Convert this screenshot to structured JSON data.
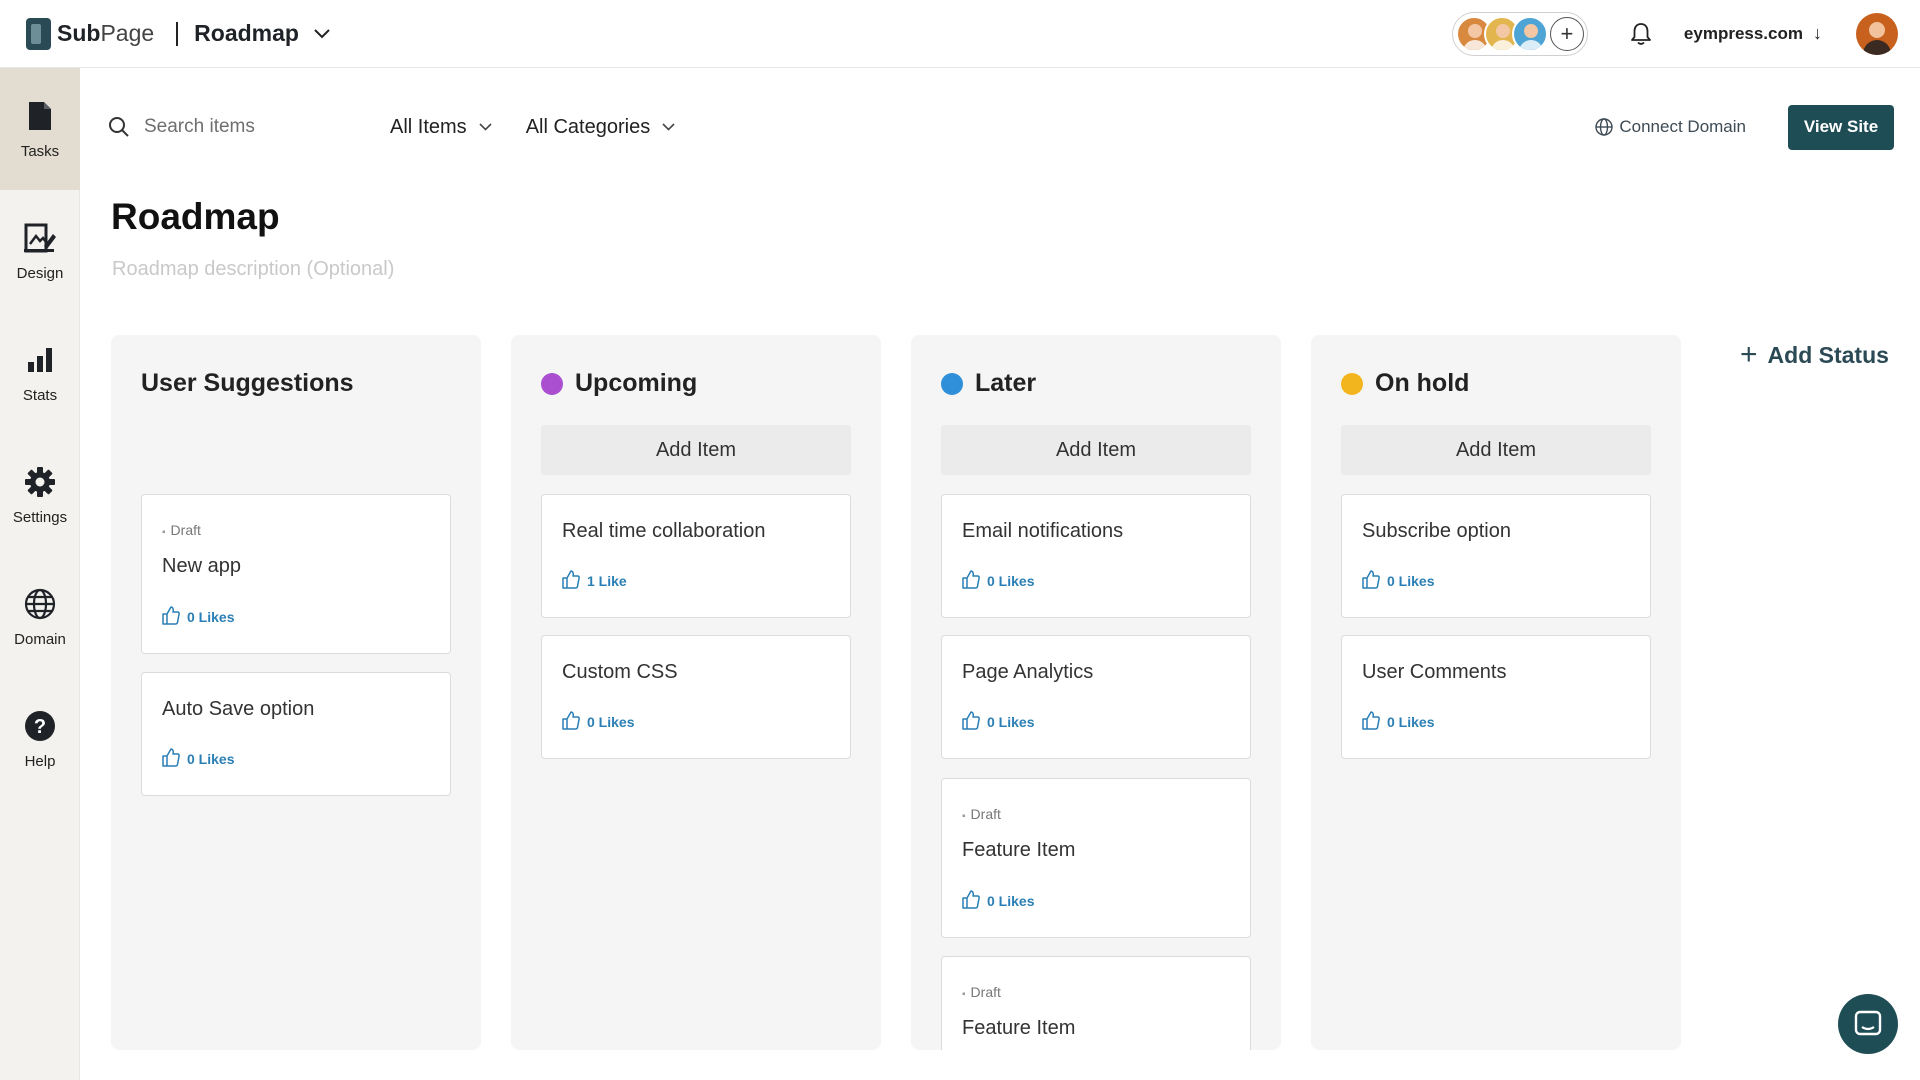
{
  "app": {
    "brand_bold": "Sub",
    "brand_rest": "Page",
    "current_page": "Roadmap",
    "site": "eympress.com"
  },
  "sidebar": {
    "items": [
      {
        "label": "Tasks",
        "icon": "tasks-icon"
      },
      {
        "label": "Design",
        "icon": "design-icon"
      },
      {
        "label": "Stats",
        "icon": "stats-icon"
      },
      {
        "label": "Settings",
        "icon": "gear-icon"
      },
      {
        "label": "Domain",
        "icon": "globe-icon"
      },
      {
        "label": "Help",
        "icon": "help-icon"
      }
    ]
  },
  "toolbar": {
    "search_placeholder": "Search items",
    "filter_items": "All Items",
    "filter_categories": "All Categories",
    "connect_domain": "Connect Domain",
    "view_site": "View Site"
  },
  "page": {
    "title": "Roadmap",
    "description_placeholder": "Roadmap description (Optional)"
  },
  "board": {
    "add_item_label": "Add Item",
    "add_status_label": "Add Status",
    "columns": [
      {
        "name": "User Suggestions",
        "dot_color": "",
        "cards": [
          {
            "draft": "Draft",
            "title": "New app",
            "likes": "0 Likes"
          },
          {
            "draft": "",
            "title": "Auto Save option",
            "likes": "0 Likes"
          }
        ]
      },
      {
        "name": "Upcoming",
        "dot_color": "#a94fd0",
        "cards": [
          {
            "draft": "",
            "title": "Real time collaboration",
            "likes": "1 Like"
          },
          {
            "draft": "",
            "title": "Custom CSS",
            "likes": "0 Likes"
          }
        ]
      },
      {
        "name": "Later",
        "dot_color": "#2f8fd8",
        "cards": [
          {
            "draft": "",
            "title": "Email notifications",
            "likes": "0 Likes"
          },
          {
            "draft": "",
            "title": "Page Analytics",
            "likes": "0 Likes"
          },
          {
            "draft": "Draft",
            "title": "Feature Item",
            "likes": "0 Likes"
          },
          {
            "draft": "Draft",
            "title": "Feature Item",
            "likes": ""
          }
        ]
      },
      {
        "name": "On hold",
        "dot_color": "#f2b51d",
        "cards": [
          {
            "draft": "",
            "title": "Subscribe option",
            "likes": "0 Likes"
          },
          {
            "draft": "",
            "title": "User Comments",
            "likes": "0 Likes"
          }
        ]
      }
    ]
  }
}
